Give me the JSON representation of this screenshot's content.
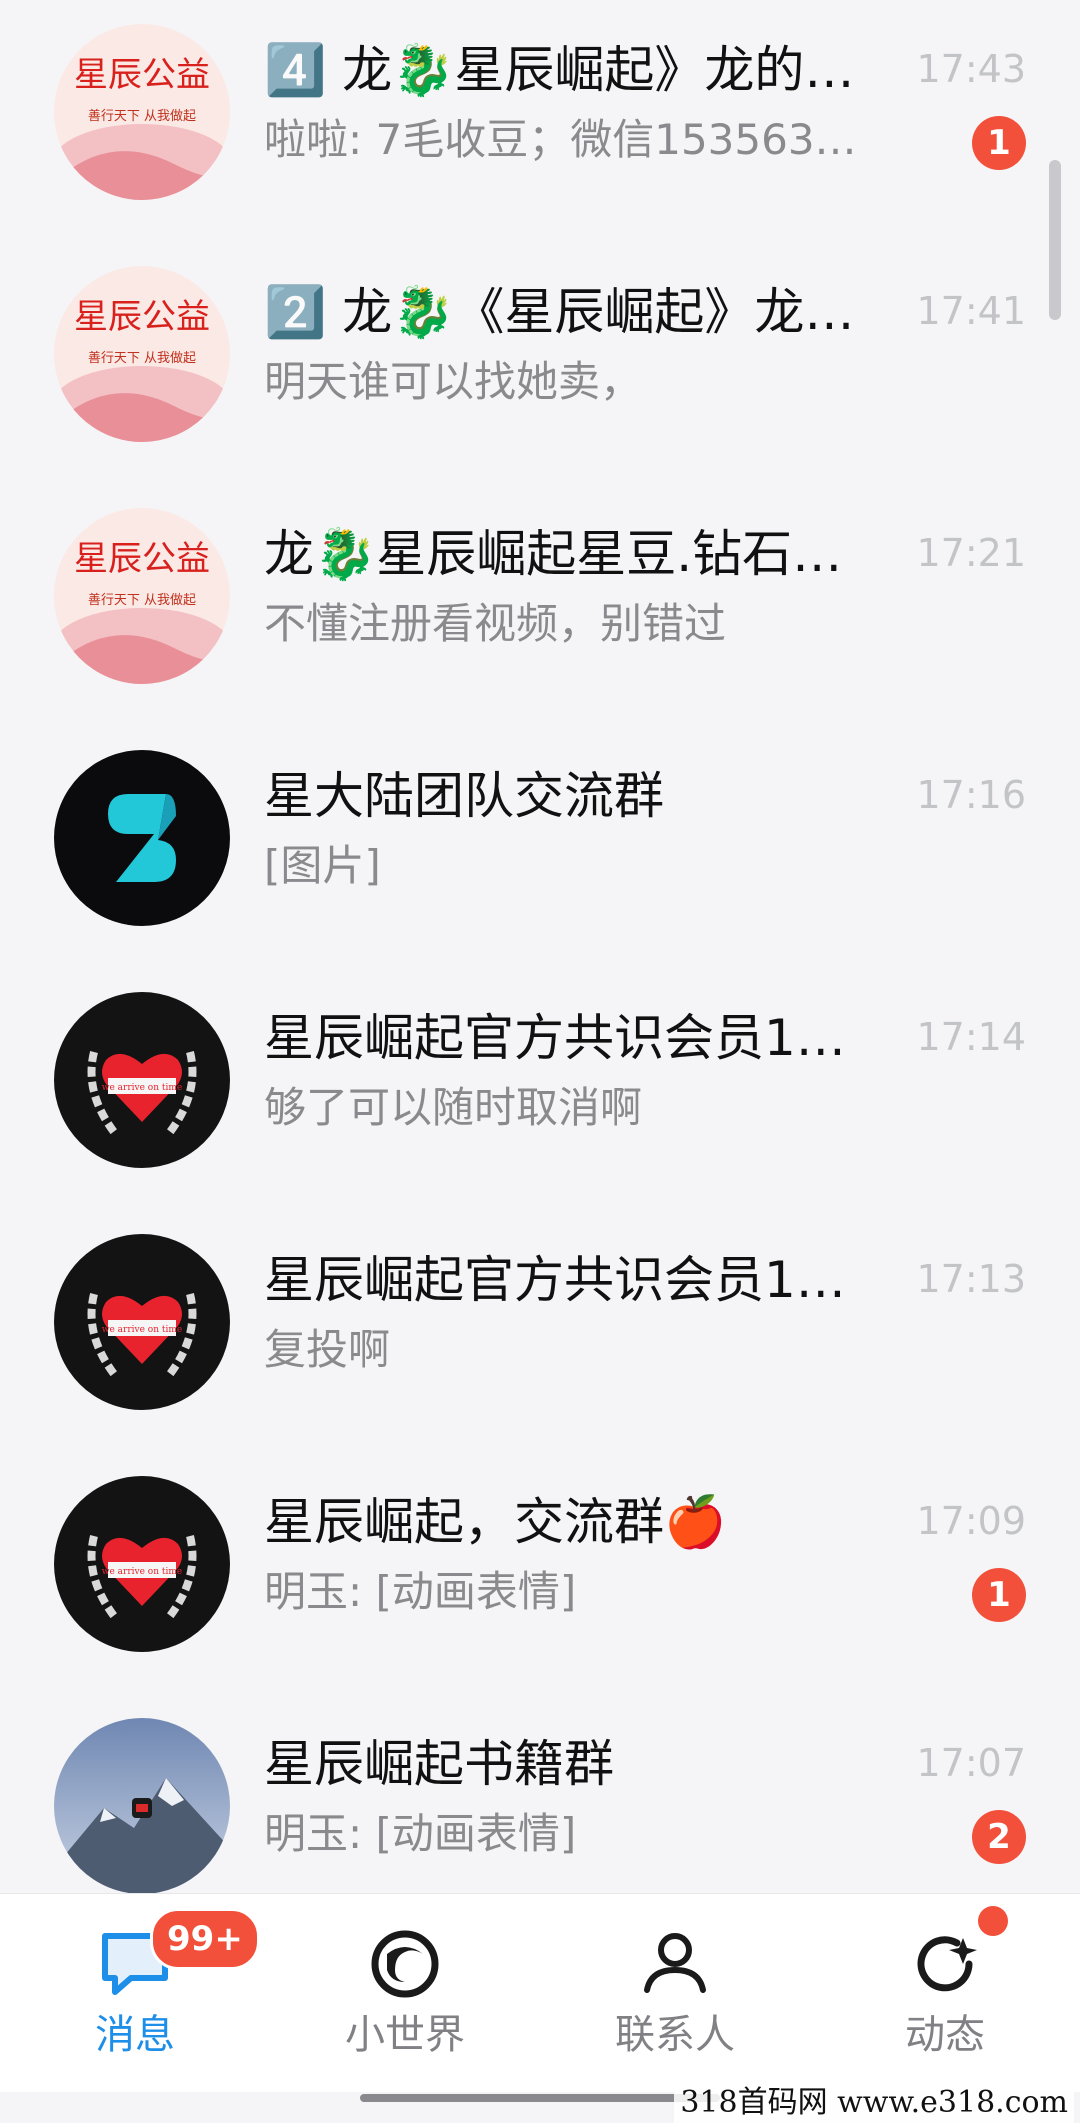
{
  "conversations": [
    {
      "title": "4️⃣ 龙🐉星辰崛起》龙的…",
      "preview": "啦啦: 7毛收豆；微信153563…",
      "time": "17:43",
      "badge": "1",
      "avatar": "xingchen-gongyi-avatar",
      "avatar_text": "星辰公益",
      "avatar_sub": "善行天下 从我做起"
    },
    {
      "title": "2️⃣ 龙🐉《星辰崛起》龙…",
      "preview": "明天谁可以找她卖，",
      "time": "17:41",
      "badge": "",
      "avatar": "xingchen-gongyi-avatar",
      "avatar_text": "星辰公益",
      "avatar_sub": "善行天下 从我做起"
    },
    {
      "title": "龙🐉星辰崛起星豆.钻石…",
      "preview": "不懂注册看视频，别错过",
      "time": "17:21",
      "badge": "",
      "avatar": "xingchen-gongyi-avatar",
      "avatar_text": "星辰公益",
      "avatar_sub": "善行天下 从我做起"
    },
    {
      "title": "星大陆团队交流群",
      "preview": "[图片]",
      "time": "17:16",
      "badge": "",
      "avatar": "s-logo-avatar"
    },
    {
      "title": "星辰崛起官方共识会员1…",
      "preview": "够了可以随时取消啊",
      "time": "17:14",
      "badge": "",
      "avatar": "heart-laurel-avatar",
      "avatar_text": "we arrive on time"
    },
    {
      "title": "星辰崛起官方共识会员1…",
      "preview": "复投啊",
      "time": "17:13",
      "badge": "",
      "avatar": "heart-laurel-avatar",
      "avatar_text": "we arrive on time"
    },
    {
      "title": "星辰崛起，交流群🍎",
      "preview": "明玉: [动画表情]",
      "time": "17:09",
      "badge": "1",
      "avatar": "heart-laurel-avatar",
      "avatar_text": "we arrive on time"
    },
    {
      "title": "星辰崛起书籍群",
      "preview": "明玉: [动画表情]",
      "time": "17:07",
      "badge": "2",
      "avatar": "mountain-avatar"
    }
  ],
  "tabbar": {
    "messages": {
      "label": "消息",
      "badge": "99+"
    },
    "world": {
      "label": "小世界"
    },
    "contacts": {
      "label": "联系人"
    },
    "moments": {
      "label": "动态"
    }
  },
  "colors": {
    "accent": "#1e8fe8",
    "badge": "#f2503b",
    "muted": "#8a8a8e",
    "time": "#c3c4c8"
  },
  "watermark": "318首码网  www.e318.com"
}
